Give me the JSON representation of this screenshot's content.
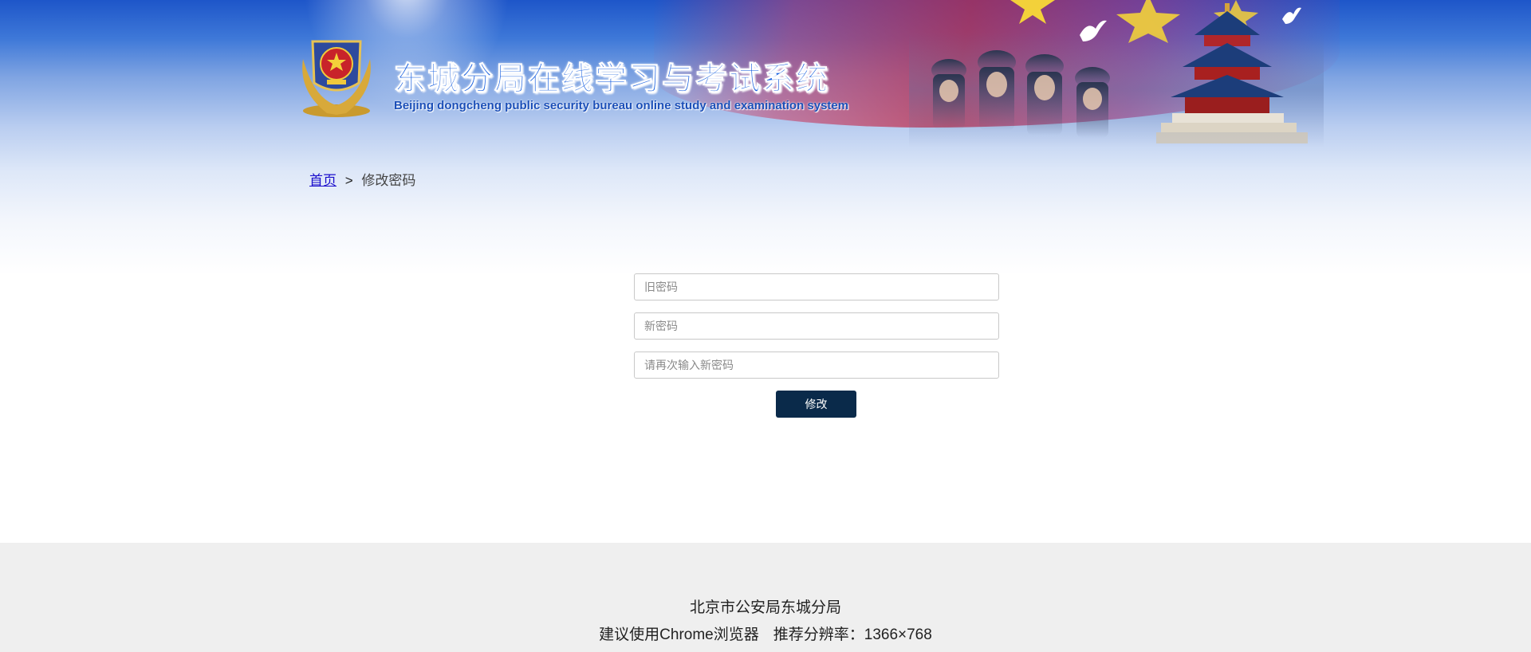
{
  "header": {
    "title_cn": "东城分局在线学习与考试系统",
    "title_en": "Beijing dongcheng public security bureau online study and examination system",
    "emblem_icon": "police-emblem-icon"
  },
  "breadcrumb": {
    "home": "首页",
    "separator": ">",
    "current": "修改密码"
  },
  "form": {
    "old_password_placeholder": "旧密码",
    "new_password_placeholder": "新密码",
    "confirm_password_placeholder": "请再次输入新密码",
    "submit_label": "修改"
  },
  "footer": {
    "line1": "北京市公安局东城分局",
    "browser_tip": "建议使用Chrome浏览器",
    "resolution_tip": "推荐分辨率：1366×768"
  },
  "colors": {
    "accent": "#0a2a4a",
    "title_blue": "#1d63e0",
    "link": "#1a0dcc",
    "footer_bg": "#efefef"
  }
}
